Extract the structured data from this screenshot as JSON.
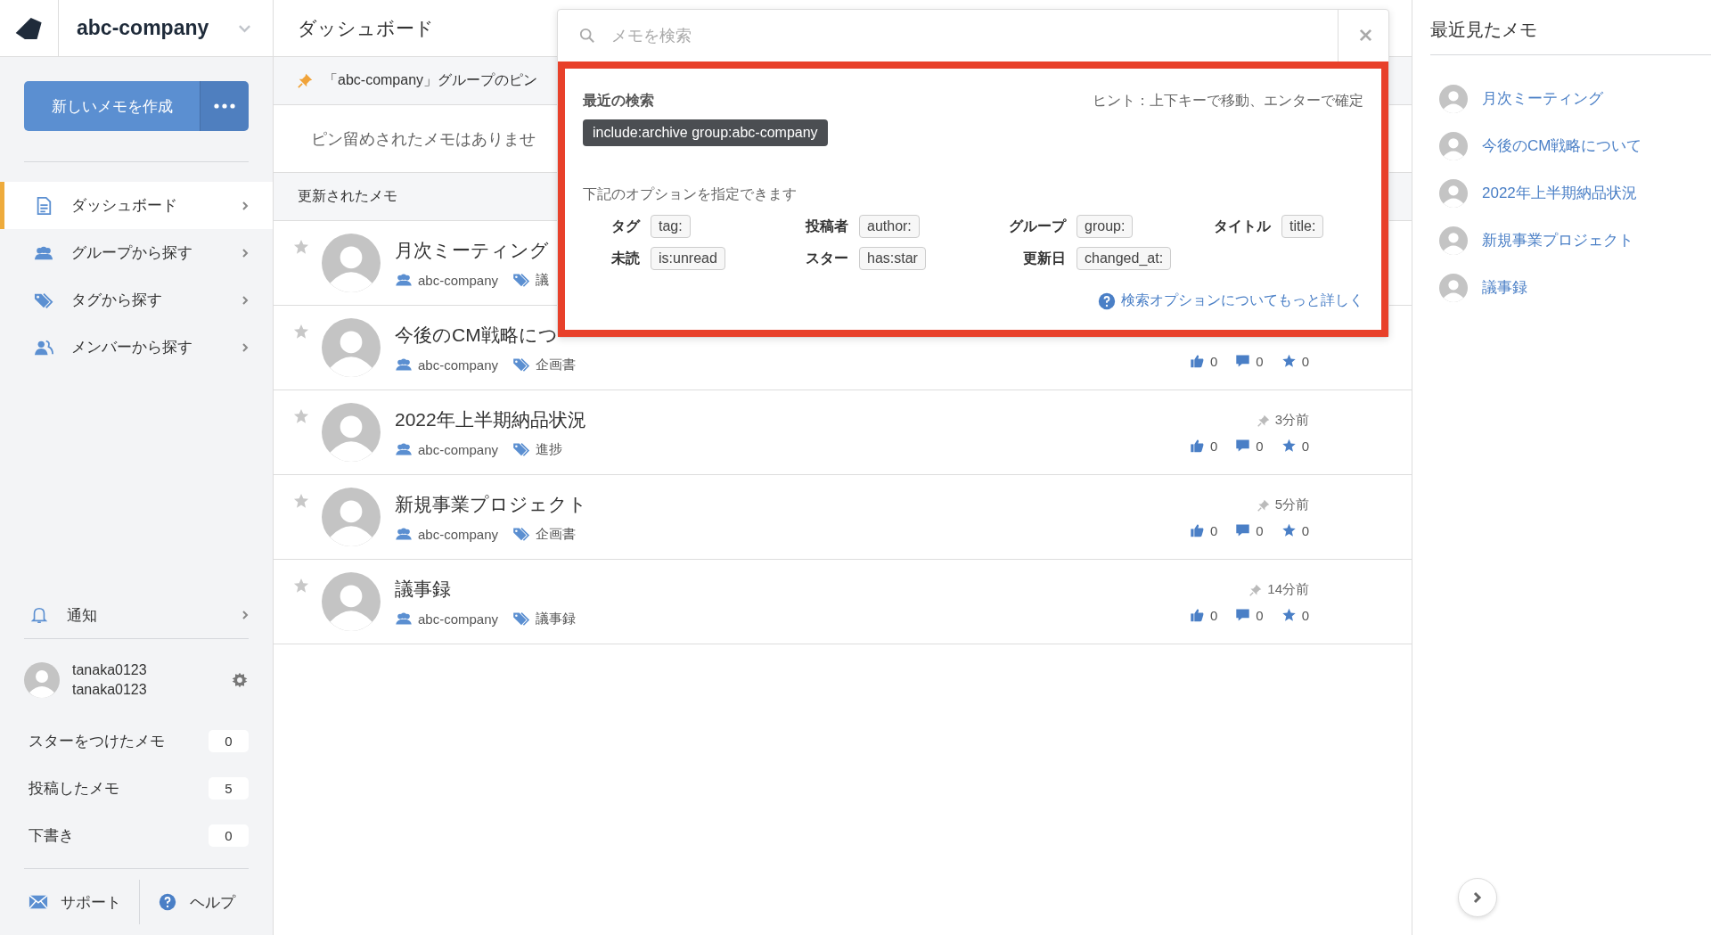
{
  "header": {
    "company": "abc-company",
    "page_title": "ダッシュボード"
  },
  "sidebar": {
    "new_memo_button": "新しいメモを作成",
    "nav": [
      {
        "kind": "dashboard",
        "label": "ダッシュボード",
        "selected": true
      },
      {
        "kind": "group",
        "label": "グループから探す",
        "selected": false
      },
      {
        "kind": "tag",
        "label": "タグから探す",
        "selected": false
      },
      {
        "kind": "member",
        "label": "メンバーから探す",
        "selected": false
      }
    ],
    "notification": "通知",
    "user": {
      "name": "tanaka0123",
      "id": "tanaka0123"
    },
    "counts": [
      {
        "label": "スターをつけたメモ",
        "count": "0"
      },
      {
        "label": "投稿したメモ",
        "count": "5"
      },
      {
        "label": "下書き",
        "count": "0"
      }
    ],
    "support": "サポート",
    "help": "ヘルプ"
  },
  "main": {
    "pinned": {
      "heading": "「abc-company」グループのピン",
      "empty": "ピン留めされたメモはありませ"
    },
    "updated": {
      "heading": "更新されたメモ",
      "memos": [
        {
          "title": "月次ミーティング",
          "group": "abc-company",
          "tag": "議",
          "starred": false
        },
        {
          "title": "今後のCM戦略につ",
          "group": "abc-company",
          "tag": "企画書",
          "starred": false,
          "likes": "0",
          "comments": "0",
          "favorites": "0"
        },
        {
          "title": "2022年上半期納品状況",
          "group": "abc-company",
          "tag": "進捗",
          "starred": false,
          "time": "3分前",
          "likes": "0",
          "comments": "0",
          "favorites": "0"
        },
        {
          "title": "新規事業プロジェクト",
          "group": "abc-company",
          "tag": "企画書",
          "starred": false,
          "time": "5分前",
          "likes": "0",
          "comments": "0",
          "favorites": "0"
        },
        {
          "title": "議事録",
          "group": "abc-company",
          "tag": "議事録",
          "starred": false,
          "time": "14分前",
          "likes": "0",
          "comments": "0",
          "favorites": "0"
        }
      ]
    }
  },
  "search": {
    "placeholder": "メモを検索",
    "recent_label": "最近の検索",
    "hint": "ヒント：上下キーで移動、エンターで確定",
    "recent": [
      "include:archive group:abc-company"
    ],
    "options_label": "下記のオプションを指定できます",
    "options": [
      {
        "label": "タグ",
        "token": "tag:"
      },
      {
        "label": "投稿者",
        "token": "author:"
      },
      {
        "label": "グループ",
        "token": "group:"
      },
      {
        "label": "タイトル",
        "token": "title:"
      },
      {
        "label": "未読",
        "token": "is:unread"
      },
      {
        "label": "スター",
        "token": "has:star"
      },
      {
        "label": "更新日",
        "token": "changed_at:"
      }
    ],
    "more_link": "検索オプションについてもっと詳しく"
  },
  "recent_memos": {
    "title": "最近見たメモ",
    "items": [
      "月次ミーティング",
      "今後のCM戦略について",
      "2022年上半期納品状況",
      "新規事業プロジェクト",
      "議事録"
    ]
  }
}
